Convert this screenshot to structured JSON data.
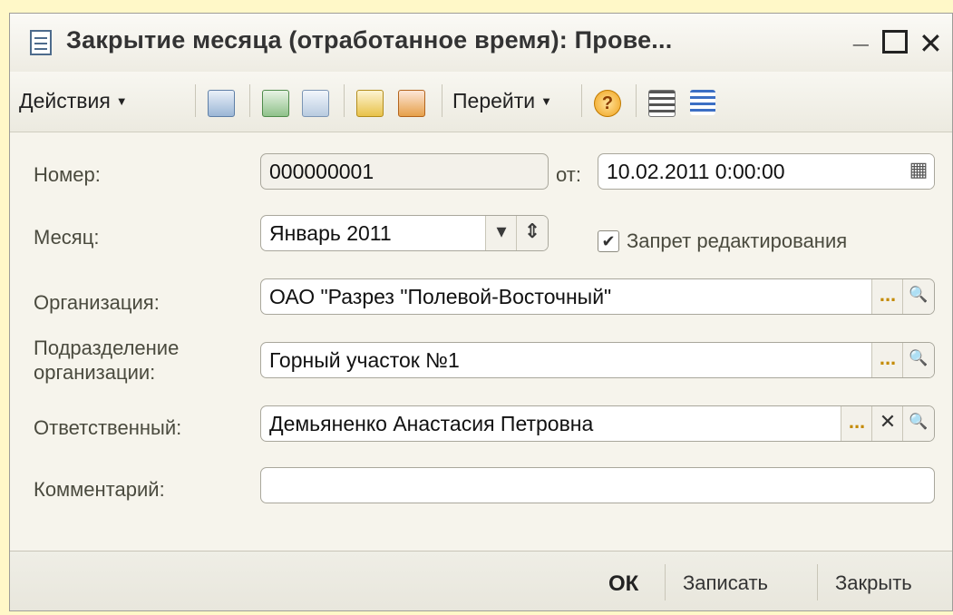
{
  "window": {
    "title": "Закрытие месяца (отработанное время): Прове...",
    "controls": {
      "minimize": "_",
      "close": "✕"
    }
  },
  "toolbar": {
    "actions_label": "Действия",
    "goto_label": "Перейти",
    "help_symbol": "?"
  },
  "form": {
    "number": {
      "label": "Номер:",
      "value": "000000001"
    },
    "date": {
      "label": "от:",
      "value": "10.02.2011  0:00:00"
    },
    "month": {
      "label": "Месяц:",
      "value": "Январь 2011"
    },
    "edit_lock": {
      "label": "Запрет редактирования",
      "checked": true,
      "mark": "✔"
    },
    "organization": {
      "label": "Организация:",
      "value": "ОАО \"Разрез \"Полевой-Восточный\""
    },
    "department": {
      "label_line1": "Подразделение",
      "label_line2": "организации:",
      "value": "Горный участок №1"
    },
    "responsible": {
      "label": "Ответственный:",
      "value": "Демьяненко Анастасия Петровна"
    },
    "comment": {
      "label": "Комментарий:",
      "value": ""
    },
    "button_glyphs": {
      "select": "...",
      "search": "🔍",
      "clear": "✕",
      "down": "▾",
      "spin": "⇕"
    }
  },
  "footer": {
    "ok_label": "ОК",
    "save_label": "Записать",
    "close_label": "Закрыть"
  },
  "colors": {
    "background": "#fff8c8",
    "window": "#f6f4ec",
    "accent": "#c48a00"
  },
  "icons": [
    "document-icon",
    "post-document-icon",
    "refresh-icon",
    "copy-icon",
    "move-in-icon",
    "move-out-icon",
    "help-icon",
    "list-icon",
    "structure-icon"
  ]
}
